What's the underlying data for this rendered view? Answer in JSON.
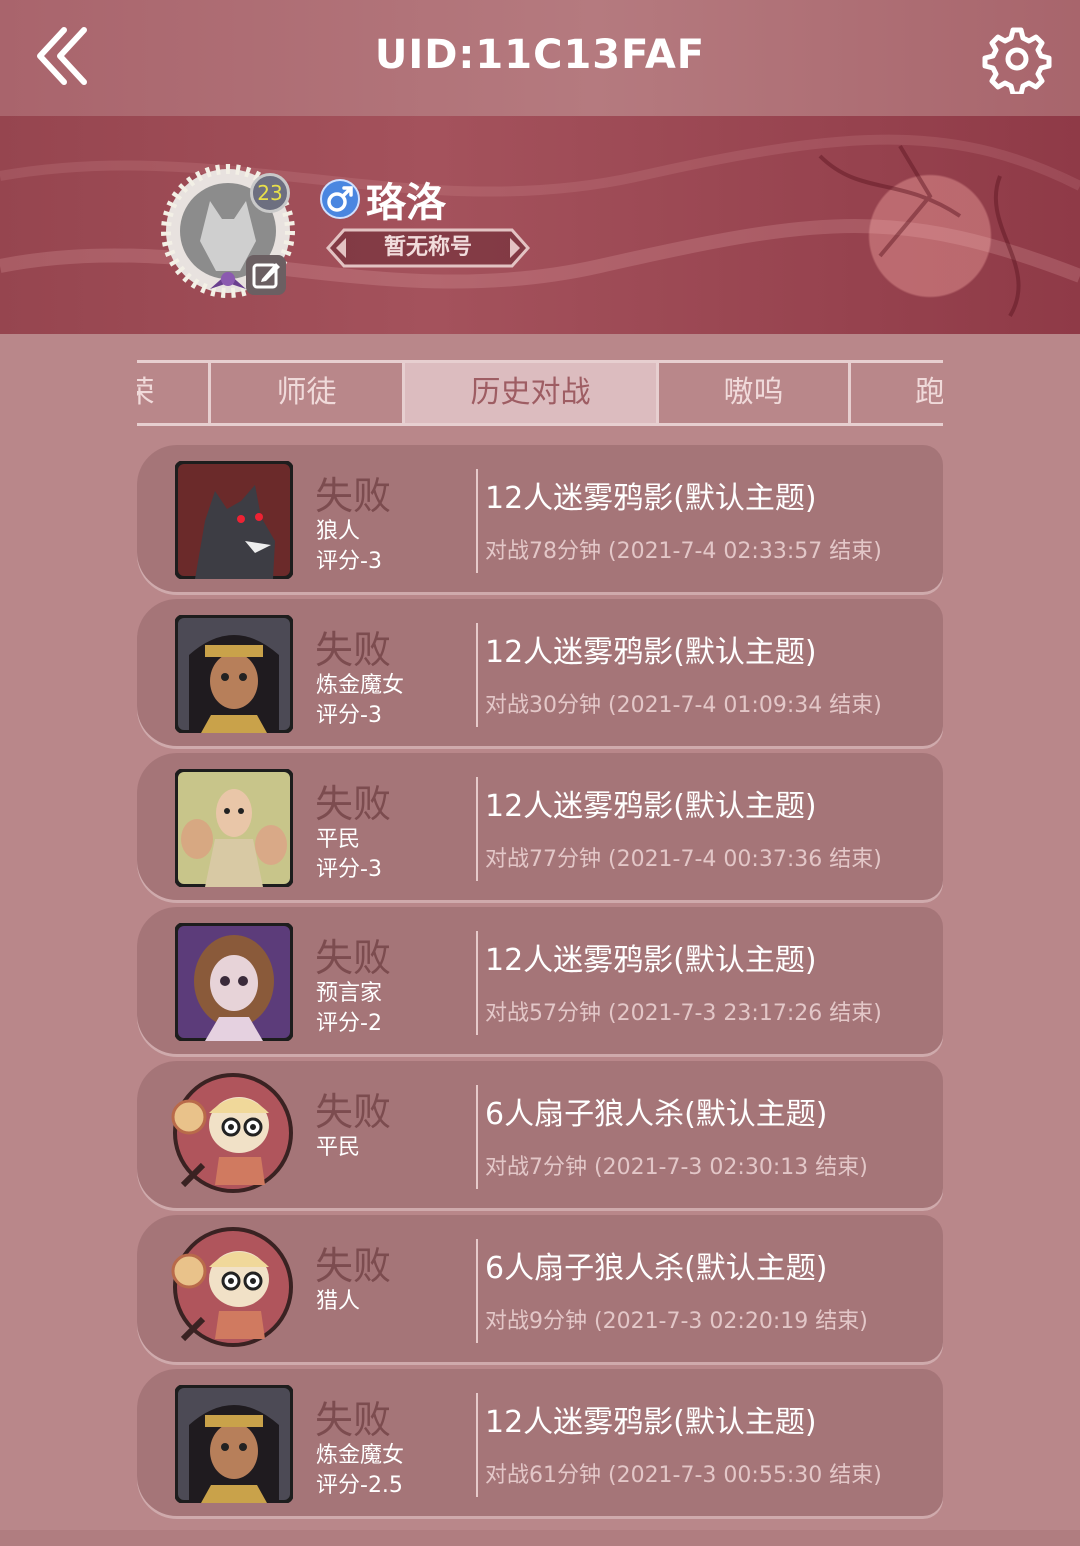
{
  "header": {
    "title": "UID:11C13FAF"
  },
  "profile": {
    "name": "珞洛",
    "level": "23",
    "title_badge": "暂无称号"
  },
  "tabs": [
    {
      "label": "荣"
    },
    {
      "label": "师徒"
    },
    {
      "label": "历史对战"
    },
    {
      "label": "嗷呜"
    },
    {
      "label": "跑"
    }
  ],
  "matches": [
    {
      "result": "失败",
      "role": "狼人",
      "score": "评分-3",
      "mode": "12人迷雾鸦影(默认主题)",
      "meta": "对战78分钟 (2021-7-4 02:33:57 结束)",
      "portrait": "werewolf"
    },
    {
      "result": "失败",
      "role": "炼金魔女",
      "score": "评分-3",
      "mode": "12人迷雾鸦影(默认主题)",
      "meta": "对战30分钟 (2021-7-4 01:09:34 结束)",
      "portrait": "witch"
    },
    {
      "result": "失败",
      "role": "平民",
      "score": "评分-3",
      "mode": "12人迷雾鸦影(默认主题)",
      "meta": "对战77分钟 (2021-7-4 00:37:36 结束)",
      "portrait": "villager"
    },
    {
      "result": "失败",
      "role": "预言家",
      "score": "评分-2",
      "mode": "12人迷雾鸦影(默认主题)",
      "meta": "对战57分钟 (2021-7-3 23:17:26 结束)",
      "portrait": "seer"
    },
    {
      "result": "失败",
      "role": "平民",
      "score": "",
      "mode": "6人扇子狼人杀(默认主题)",
      "meta": "对战7分钟 (2021-7-3 02:30:13 结束)",
      "portrait": "fan"
    },
    {
      "result": "失败",
      "role": "猎人",
      "score": "",
      "mode": "6人扇子狼人杀(默认主题)",
      "meta": "对战9分钟 (2021-7-3 02:20:19 结束)",
      "portrait": "fan"
    },
    {
      "result": "失败",
      "role": "炼金魔女",
      "score": "评分-2.5",
      "mode": "12人迷雾鸦影(默认主题)",
      "meta": "对战61分钟 (2021-7-3 00:55:30 结束)",
      "portrait": "witch"
    }
  ]
}
